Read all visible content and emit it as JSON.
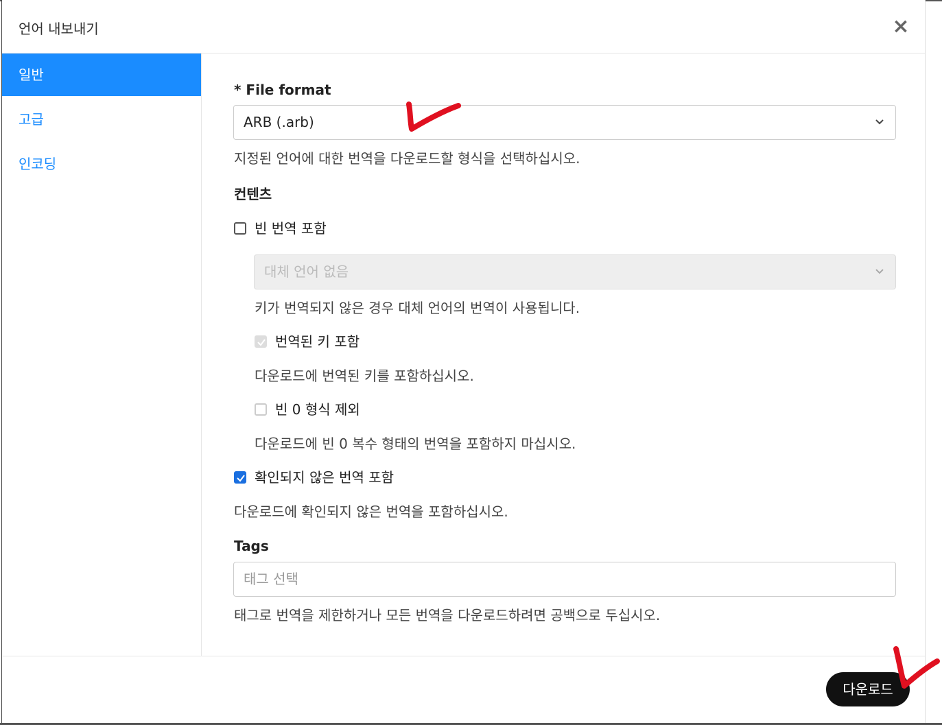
{
  "dialog": {
    "title": "언어 내보내기",
    "close_label": "×"
  },
  "sidebar": {
    "items": [
      {
        "label": "일반",
        "active": true
      },
      {
        "label": "고급",
        "active": false
      },
      {
        "label": "인코딩",
        "active": false
      }
    ]
  },
  "form": {
    "file_format": {
      "label": "* File format",
      "value": "ARB (.arb)",
      "help": "지정된 언어에 대한 번역을 다운로드할 형식을 선택하십시오."
    },
    "contents_heading": "컨텐츠",
    "include_empty": {
      "label": "빈 번역 포함",
      "checked": false
    },
    "fallback": {
      "value": "대체 언어 없음",
      "help": "키가 번역되지 않은 경우 대체 언어의 번역이 사용됩니다."
    },
    "include_translated_keys": {
      "label": "번역된 키 포함",
      "checked": true,
      "help": "다운로드에 번역된 키를 포함하십시오."
    },
    "exclude_empty_zero": {
      "label": "빈 0 형식 제외",
      "checked": false,
      "help": "다운로드에 빈 0 복수 형태의 번역을 포함하지 마십시오."
    },
    "include_unconfirmed": {
      "label": "확인되지 않은 번역 포함",
      "checked": true,
      "help": "다운로드에 확인되지 않은 번역을 포함하십시오."
    },
    "tags": {
      "label": "Tags",
      "placeholder": "태그 선택",
      "help": "태그로 번역을 제한하거나 모든 번역을 다운로드하려면 공백으로 두십시오."
    }
  },
  "footer": {
    "download_label": "다운로드"
  },
  "colors": {
    "accent": "#1a8cff",
    "checkbox_checked": "#1a6fe0",
    "annotation_mark": "#e01020"
  }
}
